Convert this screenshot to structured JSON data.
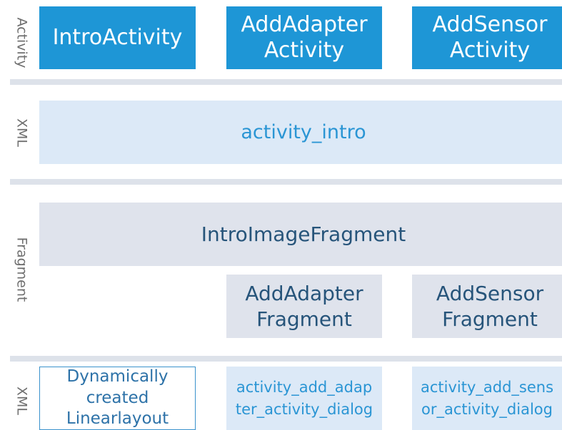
{
  "diagram": {
    "side_labels": {
      "activity": "Activity",
      "xml_top": "XML",
      "fragment": "Fragment",
      "xml_bottom": "XML"
    },
    "activities": {
      "intro": "IntroActivity",
      "add_adapter": "AddAdapter\nActivity",
      "add_sensor": "AddSensor\nActivity"
    },
    "xml_top": {
      "activity_intro": "activity_intro"
    },
    "fragments": {
      "intro_image": "IntroImageFragment",
      "add_adapter": "AddAdapter\nFragment",
      "add_sensor": "AddSensor\nFragment"
    },
    "xml_bottom": {
      "dynamic_layout": "Dynamically\ncreated\nLinearlayout",
      "adapter_dialog": "activity_add_adap\nter_activity_dialog",
      "sensor_dialog": "activity_add_sens\nor_activity_dialog"
    }
  }
}
